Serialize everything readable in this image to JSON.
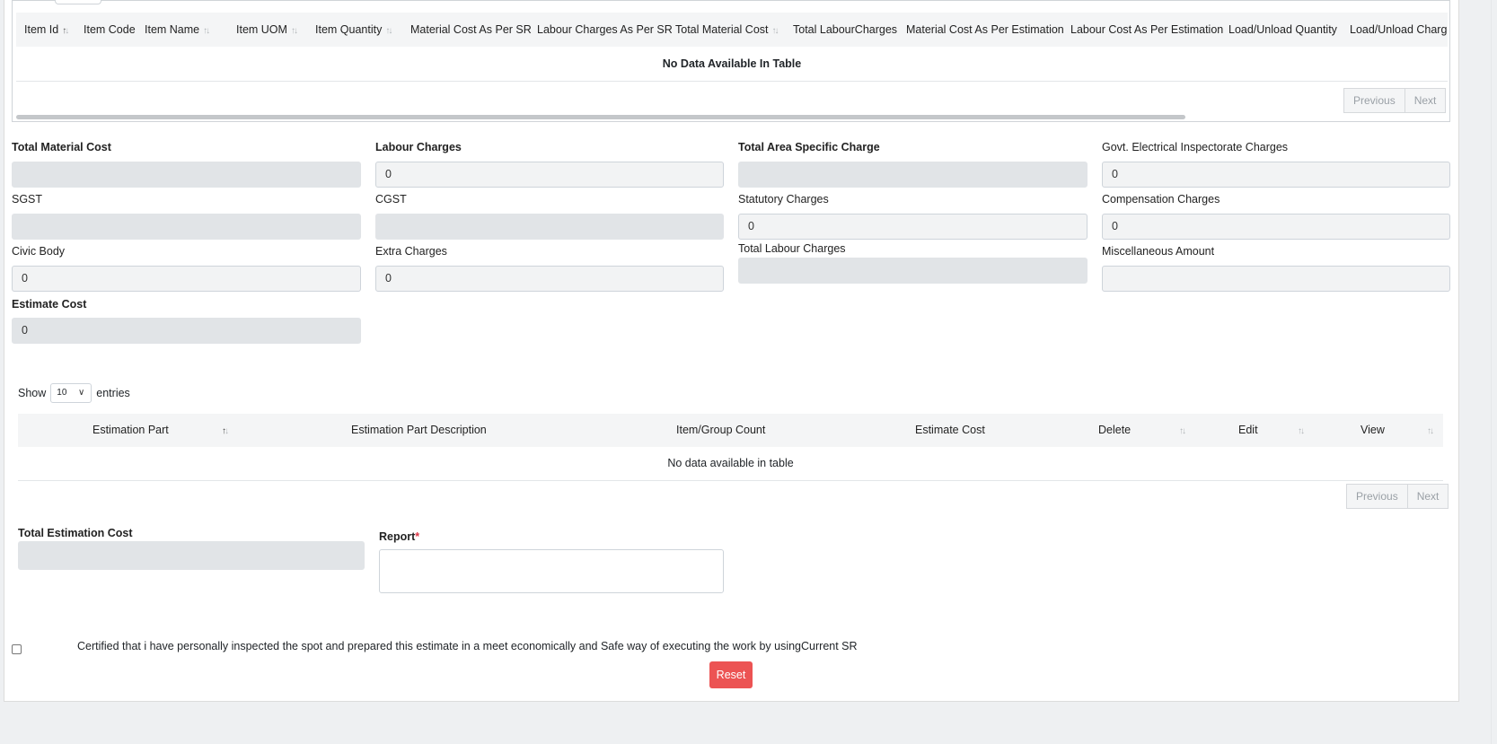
{
  "items_table": {
    "columns": [
      "Item Id",
      "Item Code",
      "Item Name",
      "Item UOM",
      "Item Quantity",
      "Material Cost As Per SR",
      "Labour Charges As Per SR",
      "Total Material Cost",
      "Total LabourCharges",
      "Material Cost As Per Estimation",
      "Labour Cost As Per Estimation",
      "Load/Unload Quantity",
      "Load/Unload Charge"
    ],
    "empty_text": "No Data Available In Table",
    "prev_label": "Previous",
    "next_label": "Next"
  },
  "form": {
    "total_material_cost": {
      "label": "Total Material Cost",
      "value": ""
    },
    "labour_charges": {
      "label": "Labour Charges",
      "value": "0"
    },
    "total_area_specific_charge": {
      "label": "Total Area Specific Charge",
      "value": ""
    },
    "govt_electrical_inspectorate_charges": {
      "label": "Govt. Electrical Inspectorate Charges",
      "value": "0"
    },
    "sgst": {
      "label": "SGST",
      "value": ""
    },
    "cgst": {
      "label": "CGST",
      "value": ""
    },
    "statutory_charges": {
      "label": "Statutory Charges",
      "value": "0"
    },
    "compensation_charges": {
      "label": "Compensation Charges",
      "value": "0"
    },
    "civic_body": {
      "label": "Civic Body",
      "value": "0"
    },
    "extra_charges": {
      "label": "Extra Charges",
      "value": "0"
    },
    "total_labour_charges": {
      "label": "Total Labour Charges",
      "value": ""
    },
    "miscellaneous_amount": {
      "label": "Miscellaneous Amount",
      "value": ""
    },
    "estimate_cost": {
      "label": "Estimate Cost",
      "value": "0"
    }
  },
  "parts_table": {
    "show_label": "Show",
    "entries_value": "10",
    "entries_label": "entries",
    "columns": [
      "Estimation Part",
      "Estimation Part Description",
      "Item/Group Count",
      "Estimate Cost",
      "Delete",
      "Edit",
      "View"
    ],
    "empty_text": "No data available in table",
    "prev_label": "Previous",
    "next_label": "Next"
  },
  "summary": {
    "total_estimation_cost_label": "Total Estimation Cost",
    "total_estimation_cost_value": "",
    "report_label": "Report",
    "report_required_mark": "*"
  },
  "certification": {
    "text": "Certified that i have personally inspected the spot and prepared this estimate in a meet economically and Safe way of executing the work by usingCurrent SR"
  },
  "actions": {
    "reset_label": "Reset"
  },
  "colors": {
    "reset_button": "#ec5353",
    "required_mark": "#dc3545",
    "disabled_field": "#e1e4e7"
  }
}
